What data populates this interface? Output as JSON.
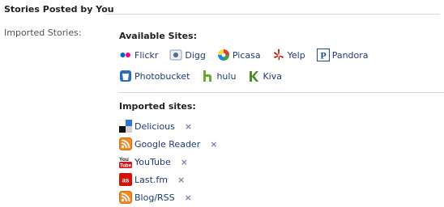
{
  "header": {
    "title": "Stories Posted by You"
  },
  "imported_stories_label": "Imported Stories:",
  "available_sites": {
    "title": "Available Sites:",
    "row1": [
      {
        "label": "Flickr",
        "icon": "flickr-icon"
      },
      {
        "label": "Digg",
        "icon": "digg-icon"
      },
      {
        "label": "Picasa",
        "icon": "picasa-icon"
      },
      {
        "label": "Yelp",
        "icon": "yelp-icon"
      },
      {
        "label": "Pandora",
        "icon": "pandora-icon"
      }
    ],
    "row2": [
      {
        "label": "Photobucket",
        "icon": "photobucket-icon"
      },
      {
        "label": "hulu",
        "icon": "hulu-icon"
      },
      {
        "label": "Kiva",
        "icon": "kiva-icon"
      }
    ]
  },
  "imported_sites": {
    "title": "Imported sites:",
    "items": [
      {
        "label": "Delicious",
        "icon": "delicious-icon",
        "remove": "×"
      },
      {
        "label": "Google Reader",
        "icon": "rss-icon",
        "remove": "×"
      },
      {
        "label": "YouTube",
        "icon": "youtube-icon",
        "remove": "×"
      },
      {
        "label": "Last.fm",
        "icon": "lastfm-icon",
        "remove": "×"
      },
      {
        "label": "Blog/RSS",
        "icon": "rss-icon",
        "remove": "×"
      }
    ]
  },
  "colors": {
    "link": "#1f3b73",
    "divider": "#d6d6d6",
    "remove": "#7b86a6"
  }
}
